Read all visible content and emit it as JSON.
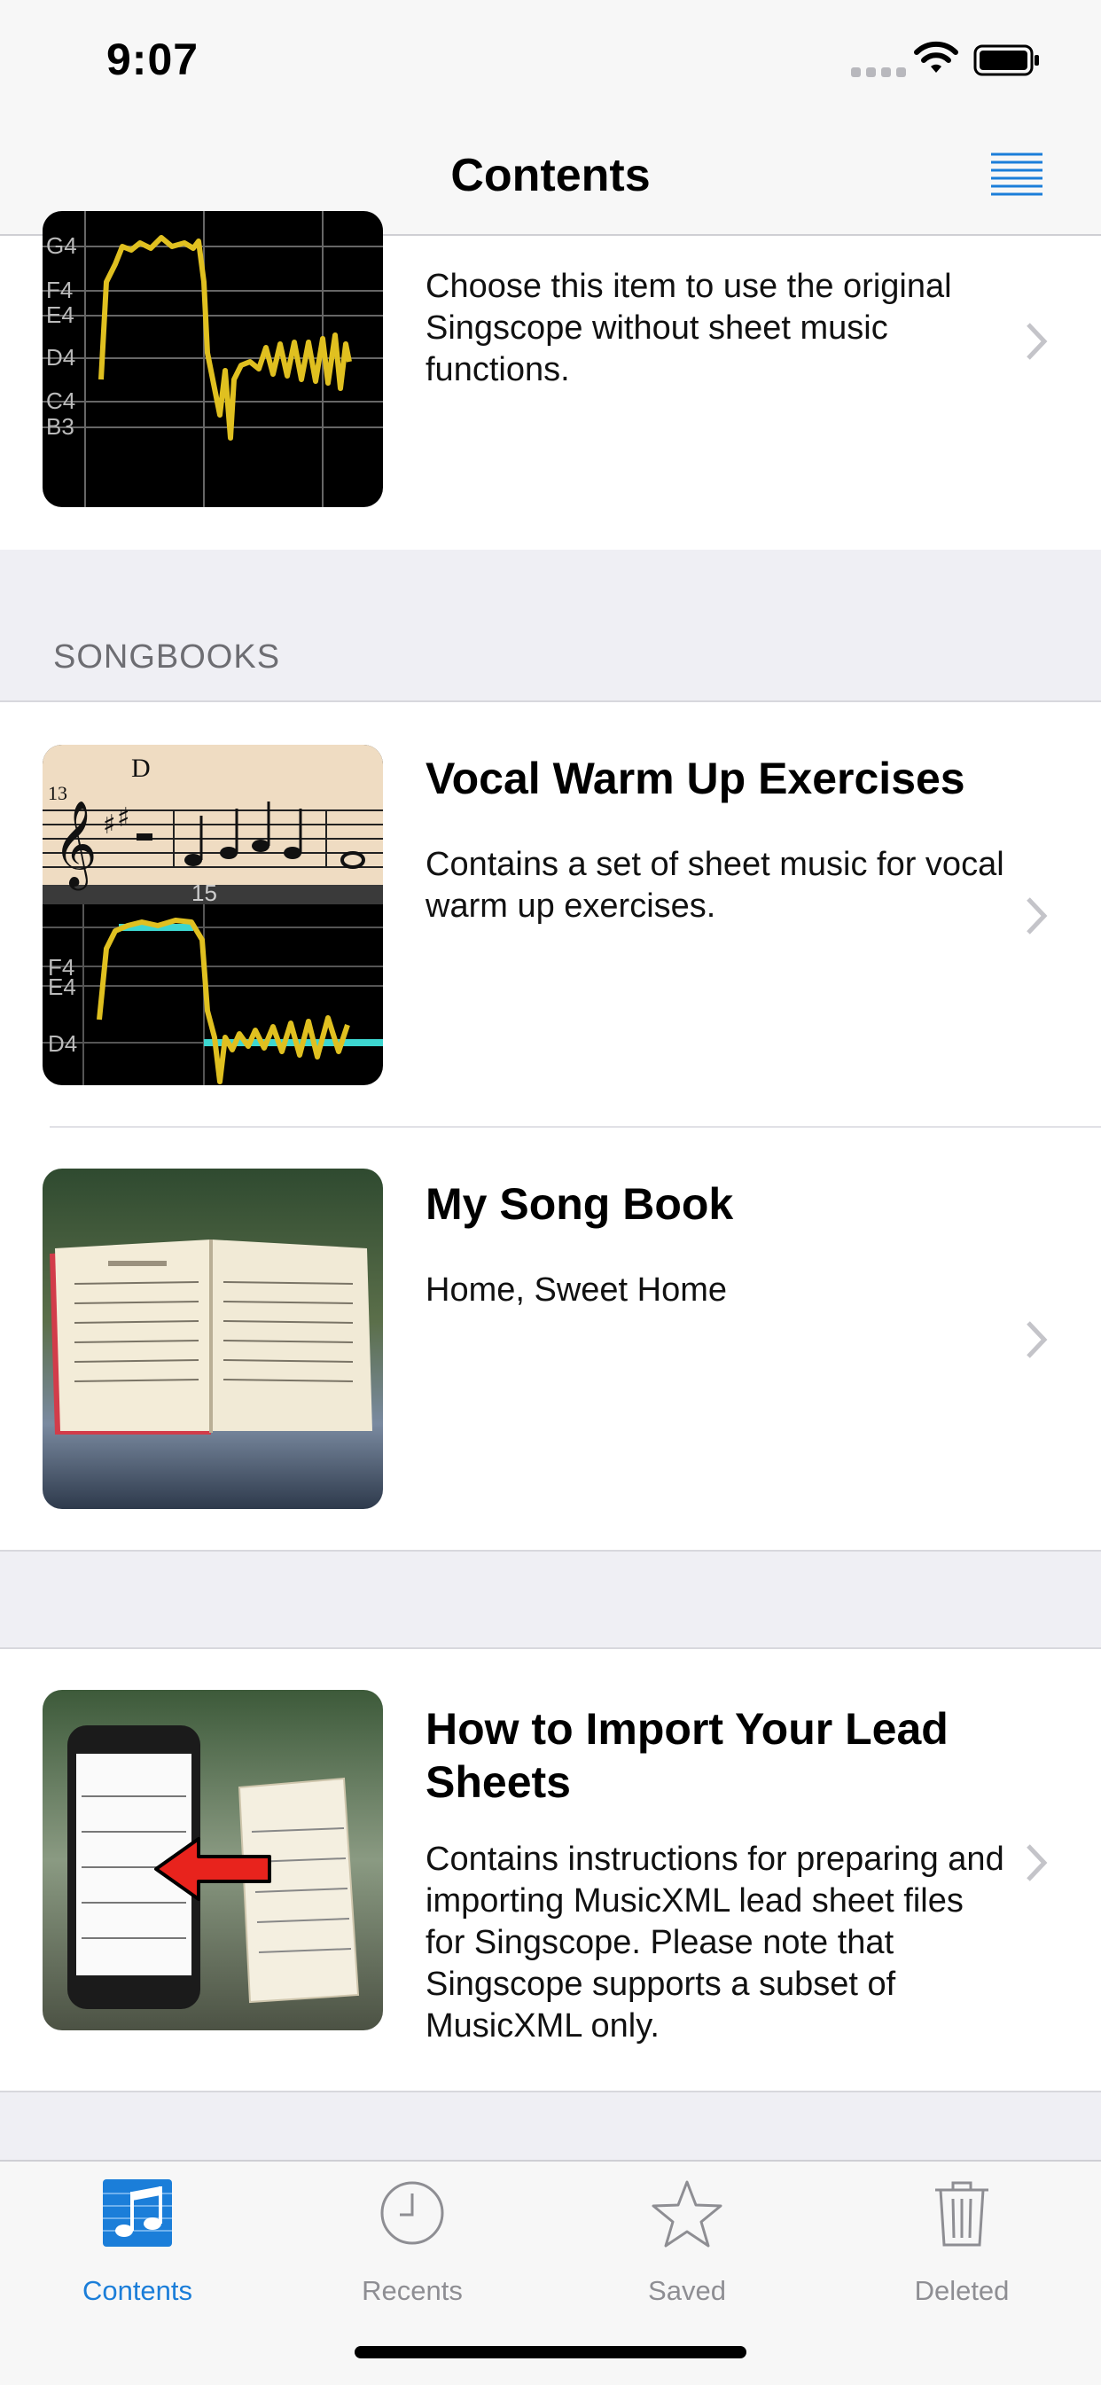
{
  "status_bar": {
    "time": "9:07"
  },
  "nav": {
    "title": "Contents",
    "menu_icon": "list-lines-icon"
  },
  "top_item": {
    "description": "Choose this item to use the original Singscope without sheet music functions.",
    "thumb_labels": [
      "G4",
      "F4",
      "E4",
      "D4",
      "C4",
      "B3"
    ]
  },
  "section": {
    "header": "SONGBOOKS"
  },
  "items": [
    {
      "title": "Vocal Warm Up Exercises",
      "description": "Contains a set of sheet music for vocal warm up exercises.",
      "thumb": {
        "measure": "13",
        "chord": "D",
        "bar_number": "15",
        "labels": [
          "F4",
          "E4",
          "D4"
        ]
      }
    },
    {
      "title": "My Song Book",
      "description": "Home, Sweet Home"
    }
  ],
  "import_item": {
    "title": "How to Import Your Lead Sheets",
    "description": "Contains instructions for preparing and importing MusicXML lead sheet files for Singscope. Please note that Singscope supports a subset of MusicXML only."
  },
  "tabs": [
    {
      "label": "Contents",
      "icon": "music-note-icon",
      "active": true
    },
    {
      "label": "Recents",
      "icon": "clock-icon",
      "active": false
    },
    {
      "label": "Saved",
      "icon": "star-icon",
      "active": false
    },
    {
      "label": "Deleted",
      "icon": "trash-icon",
      "active": false
    }
  ],
  "colors": {
    "accent": "#1b7ed9",
    "pitch_line": "#e0c020",
    "highlight": "#3dd6d0"
  }
}
